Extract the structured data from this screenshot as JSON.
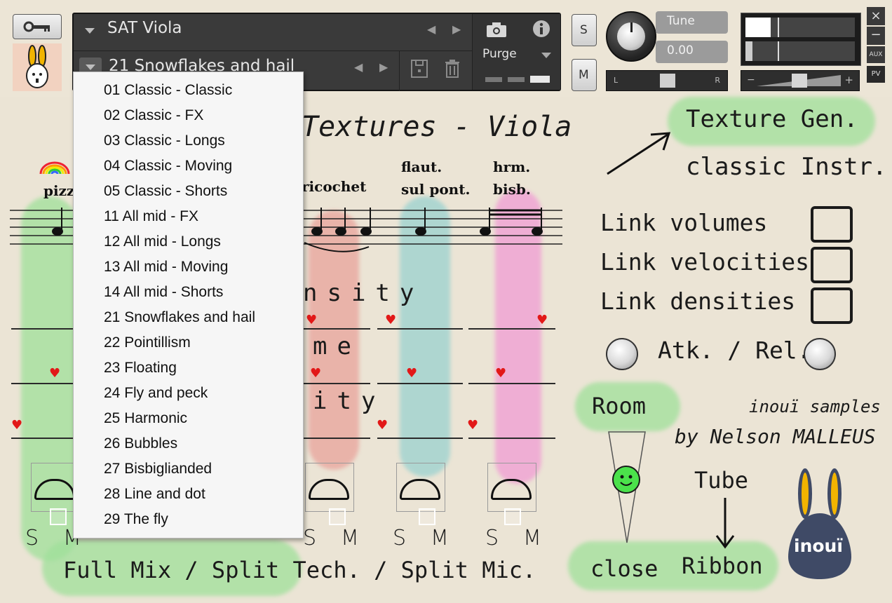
{
  "header": {
    "instrument_name": "SAT Viola",
    "preset_name": "21 Snowflakes and hail",
    "purge_label": "Purge",
    "solo_label": "S",
    "mute_label": "M",
    "tune_label": "Tune",
    "tune_value": "0.00",
    "pan_left": "L",
    "pan_right": "R",
    "vol_minus": "−",
    "vol_plus": "+",
    "close_label": "×",
    "minimize_label": "−",
    "aux_label": "AUX",
    "pv_label": "PV"
  },
  "title": "Textures - Viola",
  "techniques": [
    "pizz",
    "ricochet",
    "flaut.",
    "sul pont.",
    "hrm.",
    "bisb."
  ],
  "section_labels": {
    "density_tail": "nsity",
    "volume_tail": "me",
    "velocity_tail": "ity"
  },
  "right": {
    "texture_gen": "Texture Gen.",
    "classic_instr": "classic Instr.",
    "link_volumes": "Link volumes",
    "link_velocities": "Link velocities",
    "link_densities": "Link densities",
    "atk_rel": "Atk. / Rel.",
    "room": "Room",
    "close": "close",
    "tube": "Tube",
    "ribbon": "Ribbon",
    "credit1": "inouï samples",
    "credit2": "by Nelson MALLEUS",
    "logo_text": "inouï"
  },
  "mix_modes": "Full Mix / Split Tech. / Split Mic.",
  "sm_labels": {
    "s": "S",
    "m": "M"
  },
  "menu": {
    "items": [
      "01 Classic - Classic",
      "02 Classic - FX",
      "03 Classic - Longs",
      "04 Classic - Moving",
      "05 Classic - Shorts",
      "11 All mid - FX",
      "12 All mid - Longs",
      "13 All mid - Moving",
      "14 All mid - Shorts",
      "21 Snowflakes and hail",
      "22 Pointillism",
      "23 Floating",
      "24 Fly and peck",
      "25 Harmonic",
      "26 Bubbles",
      "27 Bisbiglianded",
      "28 Line and dot",
      "29 The fly"
    ],
    "selected": "21 Snowflakes and hail"
  },
  "colors": {
    "paper": "#ece5d6",
    "wash_green": "#9fe09a",
    "wash_red": "#e9a79f",
    "wash_teal": "#9fd3d0",
    "wash_pink": "#f0a5d4",
    "heart": "#e21818",
    "logo": "#3f4a66",
    "logo_ears": "#f2b400"
  }
}
